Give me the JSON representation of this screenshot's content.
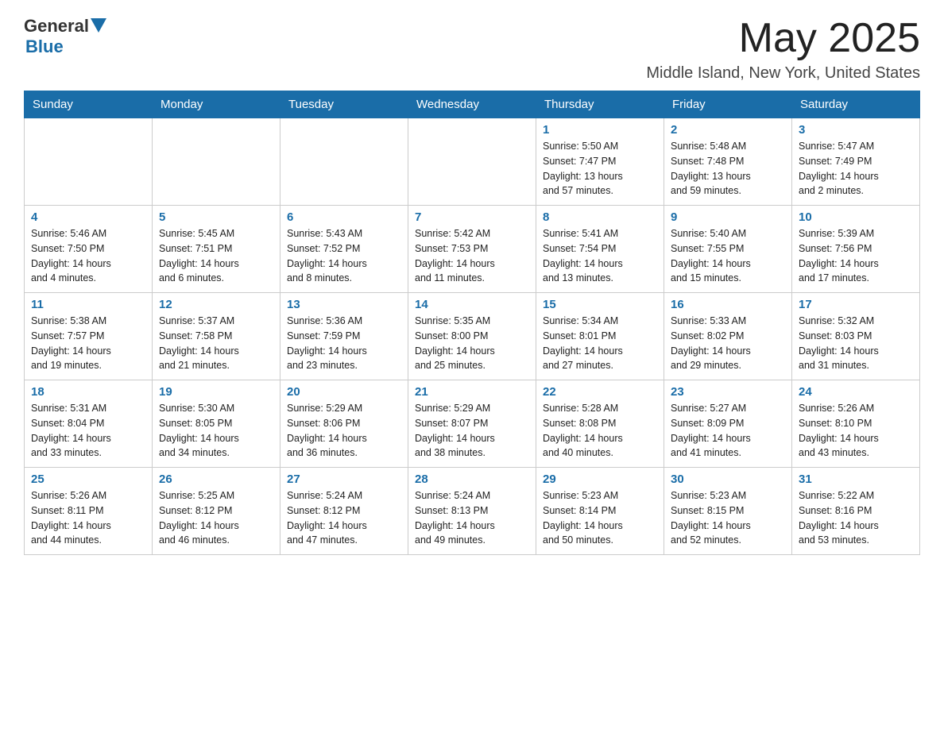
{
  "header": {
    "logo_general": "General",
    "logo_blue": "Blue",
    "month_title": "May 2025",
    "location": "Middle Island, New York, United States"
  },
  "calendar": {
    "days_of_week": [
      "Sunday",
      "Monday",
      "Tuesday",
      "Wednesday",
      "Thursday",
      "Friday",
      "Saturday"
    ],
    "weeks": [
      [
        {
          "day": "",
          "info": ""
        },
        {
          "day": "",
          "info": ""
        },
        {
          "day": "",
          "info": ""
        },
        {
          "day": "",
          "info": ""
        },
        {
          "day": "1",
          "info": "Sunrise: 5:50 AM\nSunset: 7:47 PM\nDaylight: 13 hours\nand 57 minutes."
        },
        {
          "day": "2",
          "info": "Sunrise: 5:48 AM\nSunset: 7:48 PM\nDaylight: 13 hours\nand 59 minutes."
        },
        {
          "day": "3",
          "info": "Sunrise: 5:47 AM\nSunset: 7:49 PM\nDaylight: 14 hours\nand 2 minutes."
        }
      ],
      [
        {
          "day": "4",
          "info": "Sunrise: 5:46 AM\nSunset: 7:50 PM\nDaylight: 14 hours\nand 4 minutes."
        },
        {
          "day": "5",
          "info": "Sunrise: 5:45 AM\nSunset: 7:51 PM\nDaylight: 14 hours\nand 6 minutes."
        },
        {
          "day": "6",
          "info": "Sunrise: 5:43 AM\nSunset: 7:52 PM\nDaylight: 14 hours\nand 8 minutes."
        },
        {
          "day": "7",
          "info": "Sunrise: 5:42 AM\nSunset: 7:53 PM\nDaylight: 14 hours\nand 11 minutes."
        },
        {
          "day": "8",
          "info": "Sunrise: 5:41 AM\nSunset: 7:54 PM\nDaylight: 14 hours\nand 13 minutes."
        },
        {
          "day": "9",
          "info": "Sunrise: 5:40 AM\nSunset: 7:55 PM\nDaylight: 14 hours\nand 15 minutes."
        },
        {
          "day": "10",
          "info": "Sunrise: 5:39 AM\nSunset: 7:56 PM\nDaylight: 14 hours\nand 17 minutes."
        }
      ],
      [
        {
          "day": "11",
          "info": "Sunrise: 5:38 AM\nSunset: 7:57 PM\nDaylight: 14 hours\nand 19 minutes."
        },
        {
          "day": "12",
          "info": "Sunrise: 5:37 AM\nSunset: 7:58 PM\nDaylight: 14 hours\nand 21 minutes."
        },
        {
          "day": "13",
          "info": "Sunrise: 5:36 AM\nSunset: 7:59 PM\nDaylight: 14 hours\nand 23 minutes."
        },
        {
          "day": "14",
          "info": "Sunrise: 5:35 AM\nSunset: 8:00 PM\nDaylight: 14 hours\nand 25 minutes."
        },
        {
          "day": "15",
          "info": "Sunrise: 5:34 AM\nSunset: 8:01 PM\nDaylight: 14 hours\nand 27 minutes."
        },
        {
          "day": "16",
          "info": "Sunrise: 5:33 AM\nSunset: 8:02 PM\nDaylight: 14 hours\nand 29 minutes."
        },
        {
          "day": "17",
          "info": "Sunrise: 5:32 AM\nSunset: 8:03 PM\nDaylight: 14 hours\nand 31 minutes."
        }
      ],
      [
        {
          "day": "18",
          "info": "Sunrise: 5:31 AM\nSunset: 8:04 PM\nDaylight: 14 hours\nand 33 minutes."
        },
        {
          "day": "19",
          "info": "Sunrise: 5:30 AM\nSunset: 8:05 PM\nDaylight: 14 hours\nand 34 minutes."
        },
        {
          "day": "20",
          "info": "Sunrise: 5:29 AM\nSunset: 8:06 PM\nDaylight: 14 hours\nand 36 minutes."
        },
        {
          "day": "21",
          "info": "Sunrise: 5:29 AM\nSunset: 8:07 PM\nDaylight: 14 hours\nand 38 minutes."
        },
        {
          "day": "22",
          "info": "Sunrise: 5:28 AM\nSunset: 8:08 PM\nDaylight: 14 hours\nand 40 minutes."
        },
        {
          "day": "23",
          "info": "Sunrise: 5:27 AM\nSunset: 8:09 PM\nDaylight: 14 hours\nand 41 minutes."
        },
        {
          "day": "24",
          "info": "Sunrise: 5:26 AM\nSunset: 8:10 PM\nDaylight: 14 hours\nand 43 minutes."
        }
      ],
      [
        {
          "day": "25",
          "info": "Sunrise: 5:26 AM\nSunset: 8:11 PM\nDaylight: 14 hours\nand 44 minutes."
        },
        {
          "day": "26",
          "info": "Sunrise: 5:25 AM\nSunset: 8:12 PM\nDaylight: 14 hours\nand 46 minutes."
        },
        {
          "day": "27",
          "info": "Sunrise: 5:24 AM\nSunset: 8:12 PM\nDaylight: 14 hours\nand 47 minutes."
        },
        {
          "day": "28",
          "info": "Sunrise: 5:24 AM\nSunset: 8:13 PM\nDaylight: 14 hours\nand 49 minutes."
        },
        {
          "day": "29",
          "info": "Sunrise: 5:23 AM\nSunset: 8:14 PM\nDaylight: 14 hours\nand 50 minutes."
        },
        {
          "day": "30",
          "info": "Sunrise: 5:23 AM\nSunset: 8:15 PM\nDaylight: 14 hours\nand 52 minutes."
        },
        {
          "day": "31",
          "info": "Sunrise: 5:22 AM\nSunset: 8:16 PM\nDaylight: 14 hours\nand 53 minutes."
        }
      ]
    ]
  }
}
